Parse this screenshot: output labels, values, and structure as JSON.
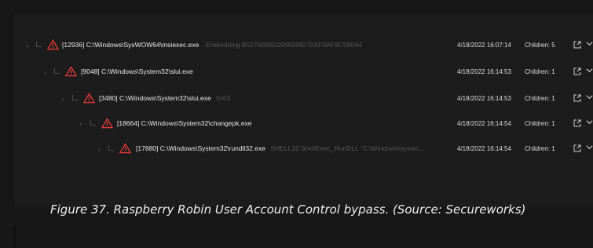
{
  "process_tree": {
    "rows": [
      {
        "pid": "[12936]",
        "path": "C:\\Windows\\SysWOW64\\msiexec.exe",
        "args": "-Embedding B5276B8602048268270AF0AF9C58044",
        "timestamp": "4/18/2022 16:07:14",
        "children": "Children: 5"
      },
      {
        "pid": "[9048]",
        "path": "C:\\Windows\\System32\\slui.exe",
        "args": "",
        "timestamp": "4/18/2022 16:14:53",
        "children": "Children: 1"
      },
      {
        "pid": "[3480]",
        "path": "C:\\Windows\\System32\\slui.exe",
        "args": "0x03",
        "timestamp": "4/18/2022 16:14:53",
        "children": "Children: 1"
      },
      {
        "pid": "[18664]",
        "path": "C:\\Windows\\System32\\changepk.exe",
        "args": "",
        "timestamp": "4/18/2022 16:14:54",
        "children": "Children: 1"
      },
      {
        "pid": "[17880]",
        "path": "C:\\Windows\\System32\\rundll32.exe",
        "args": "SHELL32.ShellExec_RunDLL \"C:\\Windows\\syswo...",
        "timestamp": "4/18/2022 16:14:54",
        "children": "Children: 1"
      }
    ]
  },
  "caption": "Figure 37. Raspberry Robin User Account Control bypass. (Source: Secureworks)",
  "colors": {
    "background": "#171717",
    "warning": "#e23a3a",
    "muted_text": "#555555"
  },
  "icons": [
    "chevron-right-icon",
    "warning-triangle-icon",
    "open-external-icon",
    "chevron-down-icon"
  ]
}
